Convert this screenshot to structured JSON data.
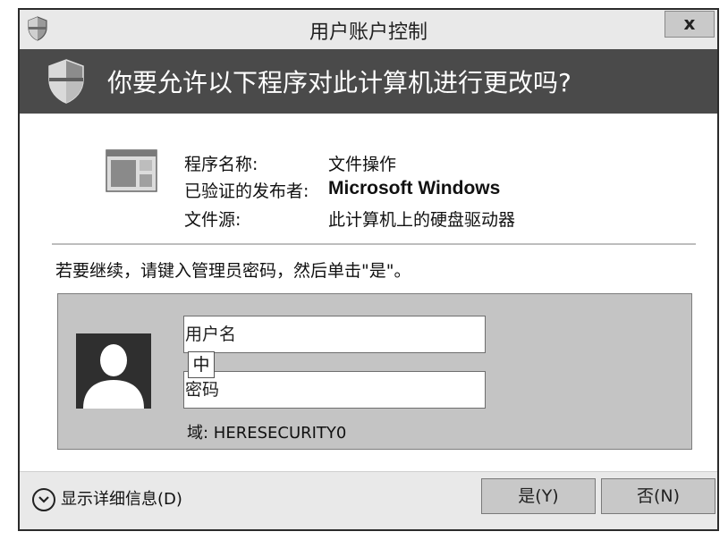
{
  "window": {
    "title": "用户账户控制",
    "close_label": "x"
  },
  "banner": {
    "question": "你要允许以下程序对此计算机进行更改吗?"
  },
  "program_info": {
    "rows": [
      {
        "label": "程序名称:",
        "value": "文件操作"
      },
      {
        "label": "已验证的发布者:",
        "value": "Microsoft Windows"
      },
      {
        "label": "文件源:",
        "value": "此计算机上的硬盘驱动器"
      }
    ]
  },
  "instruction": "若要继续，请键入管理员密码，然后单击\"是\"。",
  "credentials": {
    "username_placeholder": "用户名",
    "password_placeholder": "密码",
    "ime_indicator": "中",
    "domain": "域: HERESECURITY0"
  },
  "footer": {
    "details_label": "显示详细信息(D)",
    "yes_label": "是(Y)",
    "no_label": "否(N)"
  },
  "colors": {
    "banner": "#4a4a4a",
    "titlebar": "#e9e9e9",
    "panel": "#c4c4c4"
  },
  "icons": [
    "uac-shield-icon",
    "program-icon",
    "user-avatar-icon",
    "chevron-down-icon",
    "close-icon"
  ]
}
